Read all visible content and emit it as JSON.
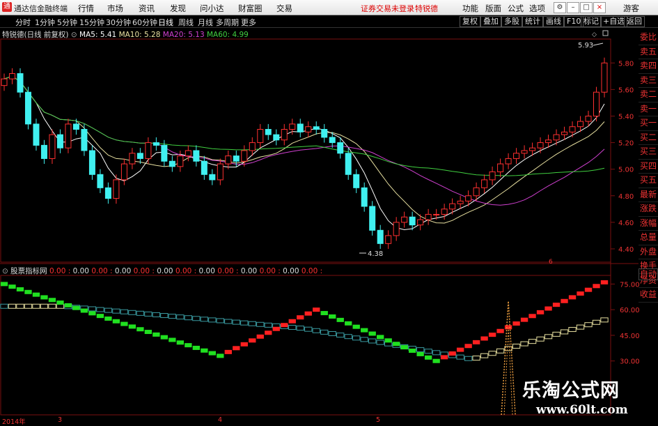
{
  "app": {
    "title": "通达信金融终端"
  },
  "menus": [
    "行情",
    "市场",
    "资讯",
    "发现",
    "问小达",
    "财富圈",
    "交易"
  ],
  "notice": {
    "trade_login": "证券交易未登录",
    "stock": "特锐德"
  },
  "right_menus": [
    "功能",
    "版面",
    "公式",
    "选项",
    "游客"
  ],
  "timeframes": [
    "分时",
    "1分钟",
    "5分钟",
    "15分钟",
    "30分钟",
    "60分钟",
    "日线",
    "周线",
    "月线",
    "多周期",
    "更多"
  ],
  "active_timeframe": "日线",
  "toolbar_right": [
    "复权",
    "叠加",
    "多股",
    "统计",
    "画线",
    "F10",
    "标记",
    "+自选",
    "返回"
  ],
  "chart_header": {
    "stock_label": "特锐德(日线 前复权)",
    "ma": [
      {
        "label": "MA5: 5.41",
        "color": "#ffffff"
      },
      {
        "label": "MA10: 5.28",
        "color": "#e8e0a0"
      },
      {
        "label": "MA20: 5.13",
        "color": "#d040d0"
      },
      {
        "label": "MA60: 4.99",
        "color": "#40d040"
      }
    ]
  },
  "price_axis": [
    "5.80",
    "5.60",
    "5.40",
    "5.20",
    "5.00",
    "4.80",
    "4.60",
    "4.40"
  ],
  "annotations": {
    "high": "5.93",
    "low": "4.38",
    "marker": "6"
  },
  "sidebar": [
    "委比",
    "卖五",
    "卖四",
    "卖三",
    "卖二",
    "卖一",
    "买一",
    "买二",
    "买三",
    "买四",
    "买五",
    "最新",
    "涨跌",
    "涨幅",
    "总量",
    "外盘",
    "换手",
    "净资",
    "收益"
  ],
  "sidebar_auto": "自动",
  "indicator": {
    "name": "股票指标网",
    "values": [
      "0.00",
      "0.00",
      "0.00",
      "0.00",
      "0.00",
      "0.00",
      "0.00",
      "0.00",
      "0.00",
      "0.00",
      "0.00",
      "0.00",
      "0.00"
    ]
  },
  "ind_axis": [
    "75.00",
    "60.00",
    "45.00",
    "30.00"
  ],
  "x_axis": [
    "2014年",
    "3",
    "4",
    "5"
  ],
  "watermark": {
    "cn": "乐淘公式网",
    "url": "www.60lt.com"
  },
  "chart_data": {
    "type": "candlestick",
    "ylim": [
      4.38,
      5.93
    ],
    "ma_values": {
      "MA5": 5.41,
      "MA10": 5.28,
      "MA20": 5.13,
      "MA60": 4.99
    },
    "ind_ylim": [
      30,
      75
    ]
  },
  "colors": {
    "up": "#ff3030",
    "down": "#40f0f0",
    "ma5": "#ffffff",
    "ma10": "#e8e0a0",
    "ma20": "#d040d0",
    "ma60": "#40d040",
    "ind_red": "#ff2020",
    "ind_green": "#20e020",
    "ind_cyan": "#3a9aa0",
    "ind_yellow": "#e8e0a0"
  }
}
